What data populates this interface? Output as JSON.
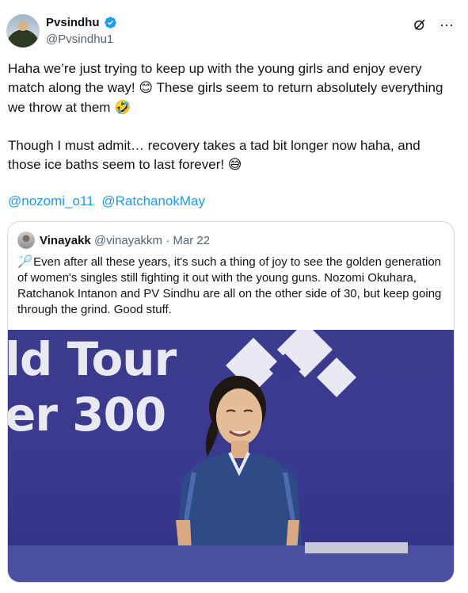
{
  "author": {
    "name": "Pvsindhu",
    "handle": "@Pvsindhu1",
    "verified": true,
    "avatar_icon": "profile-photo"
  },
  "toolbar": {
    "grok_icon": "grok-icon",
    "more_icon": "more-icon",
    "more_label": "···"
  },
  "tweet": {
    "text": "Haha we’re just trying to keep up with the young girls and enjoy every match along the way! 😊 These girls seem to return absolutely everything we throw at them 🤣\n\nThough I must admit… recovery takes a tad bit longer now haha, and those ice baths seem to last forever! 😅",
    "mentions": [
      "@nozomi_o11",
      "@RatchanokMay"
    ]
  },
  "quote": {
    "name": "Vinayakk",
    "handle": "@vinayakkm",
    "separator": "·",
    "date": "Mar 22",
    "emoji": "🏸",
    "text": "Even after all these years, it's such a thing of joy to see the golden generation of women's singles still fighting it out with the young guns. Nozomi Okuhara, Ratchanok Intanon and PV Sindhu are all on the other side of 30, but keep going through the grind. Good stuff.",
    "image": {
      "banner_line1": "ld Tour",
      "banner_line2": "er 300"
    }
  },
  "colors": {
    "link": "#1d9bf0",
    "muted": "#536471",
    "text": "#0f1419",
    "border": "#cfd9de",
    "verified": "#1d9bf0",
    "photo_bg": "#3a3990"
  }
}
